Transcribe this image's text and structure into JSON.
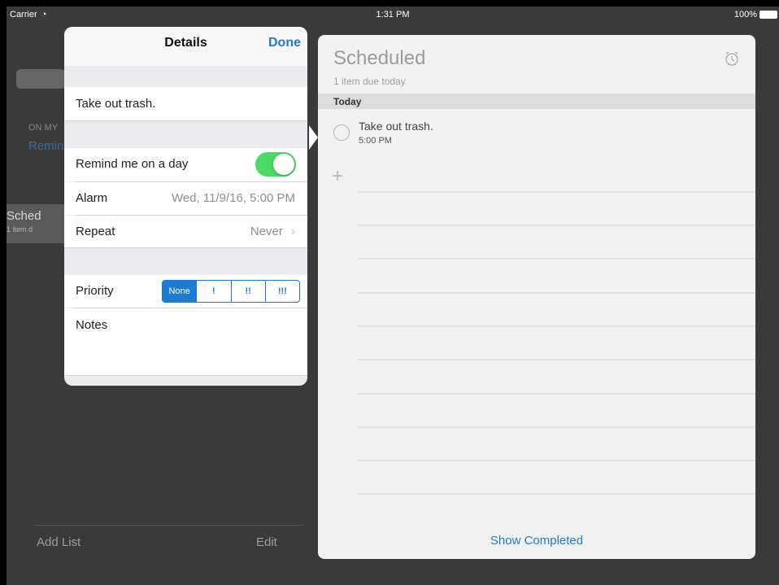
{
  "status_bar": {
    "carrier": "Carrier",
    "time": "1:31 PM",
    "battery": "100%"
  },
  "sidebar": {
    "section_header": "ON MY",
    "list_item": "Remin",
    "selected_list": "Sched",
    "selected_list_sub": "1 item d",
    "add_list_label": "Add List",
    "edit_label": "Edit"
  },
  "panel": {
    "title": "Scheduled",
    "subtitle": "1 item due today",
    "section_header": "Today",
    "reminders": [
      {
        "text": "Take out trash.",
        "time": "5:00 PM"
      }
    ],
    "add_icon": "plus-icon",
    "alarm_icon": "alarm-clock-icon",
    "show_completed_label": "Show Completed"
  },
  "details": {
    "title": "Details",
    "done_label": "Done",
    "reminder_title": "Take out trash.",
    "remind_day_label": "Remind me on a day",
    "remind_day_on": true,
    "alarm_label": "Alarm",
    "alarm_value": "Wed, 11/9/16, 5:00 PM",
    "repeat_label": "Repeat",
    "repeat_value": "Never",
    "priority_label": "Priority",
    "priority_options": [
      "None",
      "!",
      "!!",
      "!!!"
    ],
    "priority_selected": "None",
    "notes_label": "Notes"
  },
  "colors": {
    "accent": "#1e7bd5",
    "toggle_on": "#4cd964",
    "dim_background": "#3a3a3a"
  }
}
